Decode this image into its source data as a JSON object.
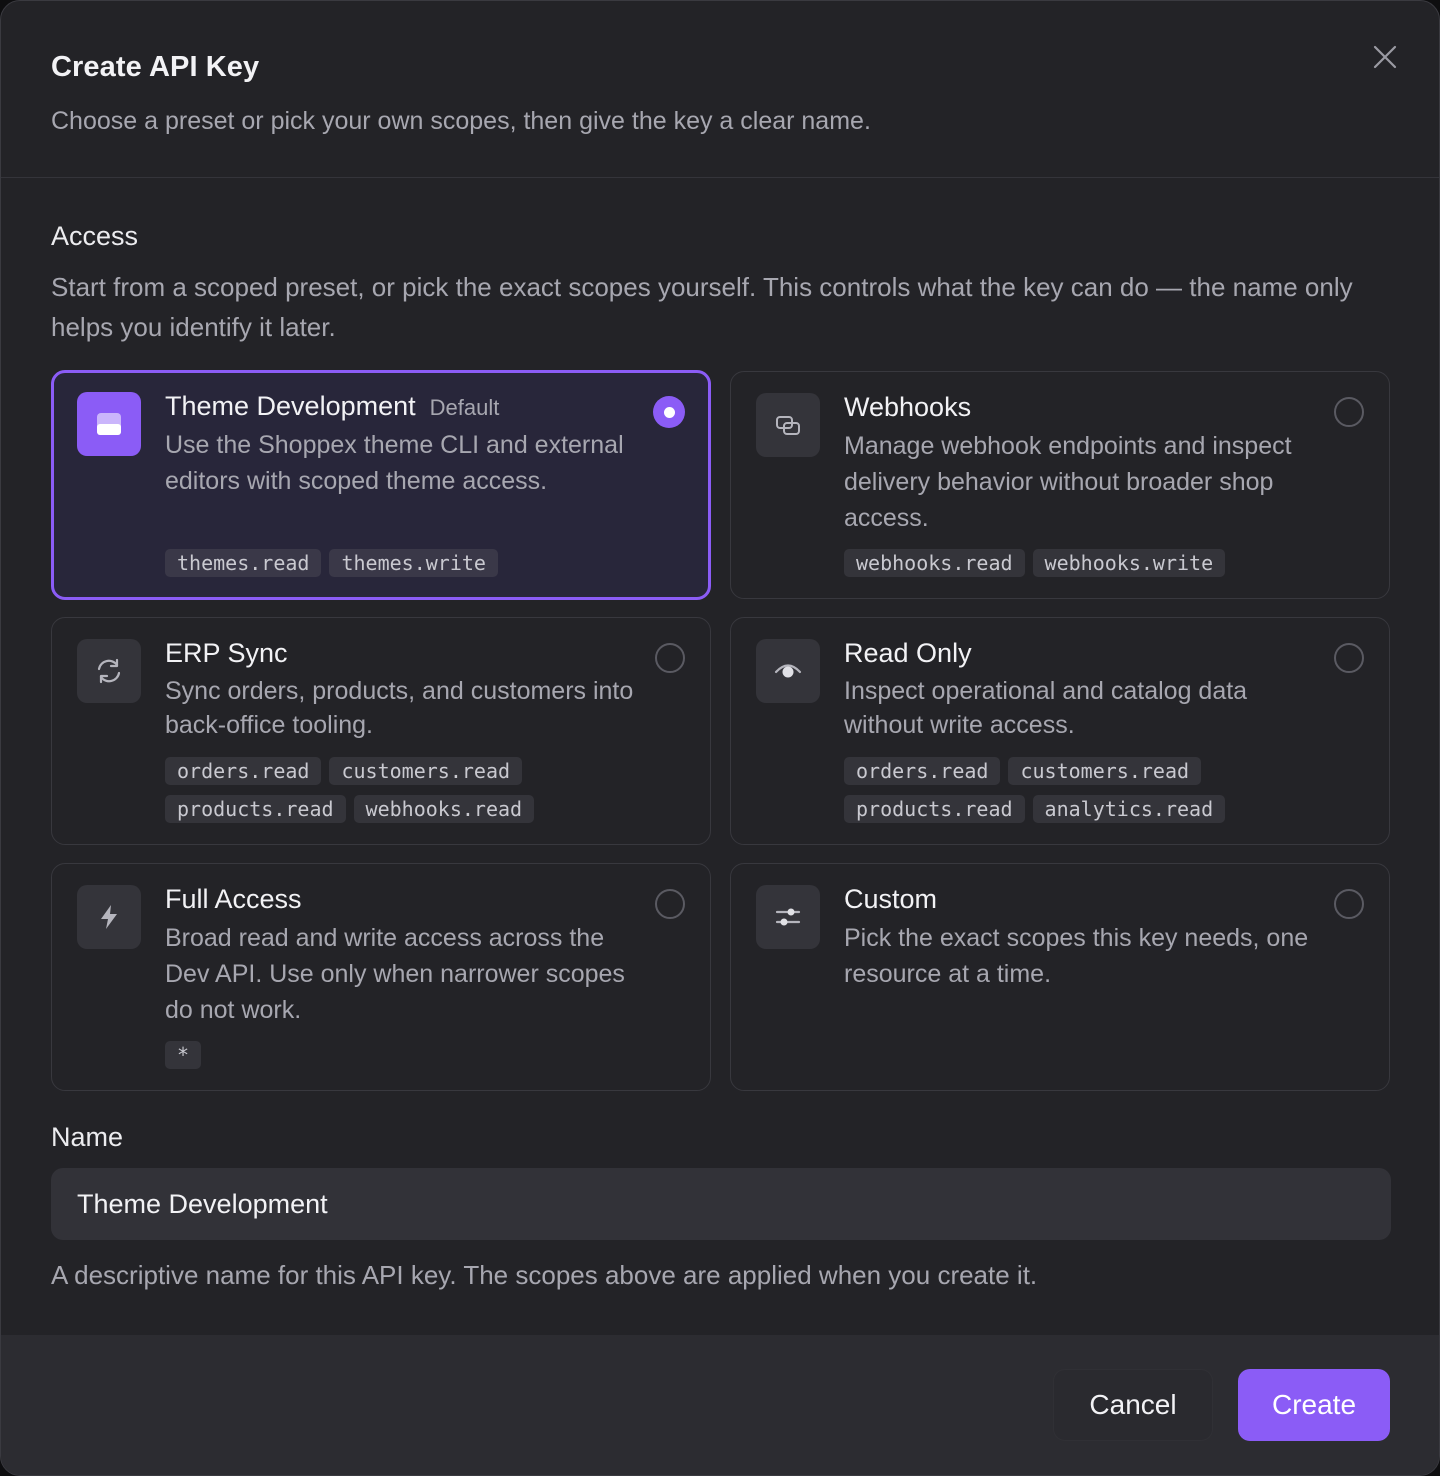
{
  "dialog": {
    "title": "Create API Key",
    "subtitle": "Choose a preset or pick your own scopes, then give the key a clear name."
  },
  "access": {
    "label": "Access",
    "description": "Start from a scoped preset, or pick the exact scopes yourself. This controls what the key can do — the name only helps you identify it later."
  },
  "presets": [
    {
      "name": "Theme Development",
      "badge": "Default",
      "description": "Use the Shoppex theme CLI and external editors with scoped theme access.",
      "scopes": [
        "themes.read",
        "themes.write"
      ],
      "icon": "theme-icon",
      "selected": true
    },
    {
      "name": "Webhooks",
      "description": "Manage webhook endpoints and inspect delivery behavior without broader shop access.",
      "scopes": [
        "webhooks.read",
        "webhooks.write"
      ],
      "icon": "webhook-icon",
      "selected": false
    },
    {
      "name": "ERP Sync",
      "description": "Sync orders, products, and customers into back-office tooling.",
      "scopes": [
        "orders.read",
        "customers.read",
        "products.read",
        "webhooks.read"
      ],
      "icon": "sync-icon",
      "selected": false
    },
    {
      "name": "Read Only",
      "description": "Inspect operational and catalog data without write access.",
      "scopes": [
        "orders.read",
        "customers.read",
        "products.read",
        "analytics.read"
      ],
      "icon": "eye-icon",
      "selected": false
    },
    {
      "name": "Full Access",
      "description": "Broad read and write access across the Dev API. Use only when narrower scopes do not work.",
      "scopes": [
        "*"
      ],
      "icon": "lightning-icon",
      "selected": false
    },
    {
      "name": "Custom",
      "description": "Pick the exact scopes this key needs, one resource at a time.",
      "scopes": [],
      "icon": "sliders-icon",
      "selected": false
    }
  ],
  "name_field": {
    "label": "Name",
    "value": "Theme Development",
    "help": "A descriptive name for this API key. The scopes above are applied when you create it."
  },
  "footer": {
    "cancel_label": "Cancel",
    "create_label": "Create"
  },
  "colors": {
    "accent": "#8b5cf6",
    "background": "#232327",
    "footer": "#2c2c31"
  }
}
